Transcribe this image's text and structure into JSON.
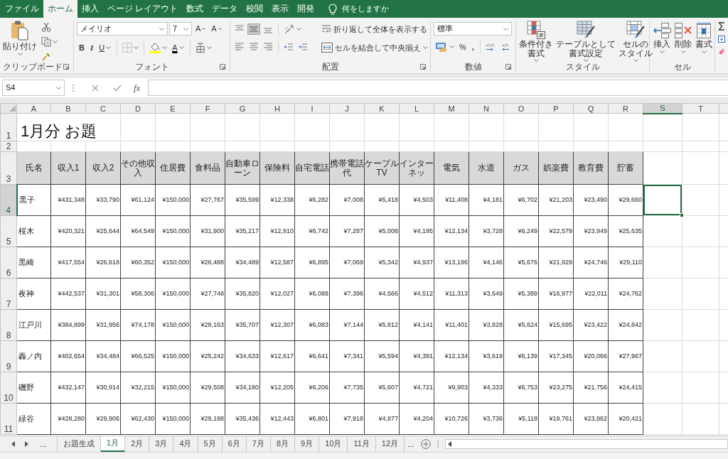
{
  "ribbon_tabs": [
    {
      "label": "ファイル",
      "selected": false
    },
    {
      "label": "ホーム",
      "selected": true
    },
    {
      "label": "挿入",
      "selected": false
    },
    {
      "label": "ページ レイアウト",
      "selected": false
    },
    {
      "label": "数式",
      "selected": false
    },
    {
      "label": "データ",
      "selected": false
    },
    {
      "label": "校閲",
      "selected": false
    },
    {
      "label": "表示",
      "selected": false
    },
    {
      "label": "開発",
      "selected": false
    }
  ],
  "tell_me": "何をしますか",
  "ribbon": {
    "clipboard": {
      "paste": "貼り付け",
      "label": "クリップボード"
    },
    "font": {
      "name": "メイリオ",
      "size": "7",
      "grow": "A",
      "shrink": "A",
      "bold": "B",
      "italic": "I",
      "underline": "U",
      "font_color": "A",
      "label": "フォント"
    },
    "alignment": {
      "vertical": [
        {
          "kind": "top",
          "selected": false
        },
        {
          "kind": "middle",
          "selected": true
        },
        {
          "kind": "bottom",
          "selected": false
        }
      ],
      "horizontal": [
        {
          "kind": "left",
          "selected": false
        },
        {
          "kind": "center",
          "selected": false
        },
        {
          "kind": "right",
          "selected": false
        }
      ],
      "wrap_text": "折り返して全体を表示する",
      "merge": "セルを結合して中央揃え",
      "label": "配置"
    },
    "number": {
      "format": "標準",
      "percent": "%",
      "comma": ",",
      "label": "数値"
    },
    "styles": {
      "buttons": [
        {
          "kind": "conditional",
          "lines": [
            "条件付き",
            "書式"
          ]
        },
        {
          "kind": "table",
          "lines": [
            "テーブルとして",
            "書式設定"
          ]
        },
        {
          "kind": "cell",
          "lines": [
            "セルの",
            "スタイル"
          ]
        }
      ],
      "label": "スタイル"
    },
    "cells": {
      "buttons": [
        {
          "kind": "insert",
          "label": "挿入"
        },
        {
          "kind": "delete",
          "label": "削除"
        },
        {
          "kind": "format",
          "label": "書式"
        }
      ],
      "label": "セル"
    }
  },
  "formula_bar": {
    "name_box": "S4",
    "function": "fx"
  },
  "sheet": {
    "columns": [
      {
        "label": "A",
        "selected": false
      },
      {
        "label": "B",
        "selected": false
      },
      {
        "label": "C",
        "selected": false
      },
      {
        "label": "D",
        "selected": false
      },
      {
        "label": "E",
        "selected": false
      },
      {
        "label": "F",
        "selected": false
      },
      {
        "label": "G",
        "selected": false
      },
      {
        "label": "H",
        "selected": false
      },
      {
        "label": "I",
        "selected": false
      },
      {
        "label": "J",
        "selected": false
      },
      {
        "label": "K",
        "selected": false
      },
      {
        "label": "L",
        "selected": false
      },
      {
        "label": "M",
        "selected": false
      },
      {
        "label": "N",
        "selected": false
      },
      {
        "label": "O",
        "selected": false
      },
      {
        "label": "P",
        "selected": false
      },
      {
        "label": "Q",
        "selected": false
      },
      {
        "label": "R",
        "selected": false
      },
      {
        "label": "S",
        "selected": true
      },
      {
        "label": "T",
        "selected": false
      }
    ],
    "rows": [
      {
        "number": "1",
        "selected": false,
        "kind": "title",
        "title": "1月分 お題"
      },
      {
        "number": "2",
        "selected": false,
        "kind": "blank"
      },
      {
        "number": "3",
        "selected": false,
        "kind": "header",
        "cells": [
          "氏名",
          "収入1",
          "収入2",
          "その他収入",
          "住居費",
          "食料品",
          "自動車ローン",
          "保険料",
          "自宅電話",
          "携帯電話代",
          "ケーブルTV",
          "インターネッ",
          "電気",
          "水道",
          "ガス",
          "娯楽費",
          "教育費",
          "貯蓄"
        ]
      },
      {
        "number": "4",
        "selected": true,
        "kind": "data",
        "cells": [
          "黒子",
          "¥431,348",
          "¥33,790",
          "¥61,124",
          "¥150,000",
          "¥27,767",
          "¥35,599",
          "¥12,338",
          "¥6,282",
          "¥7,008",
          "¥5,418",
          "¥4,503",
          "¥11,408",
          "¥4,181",
          "¥6,702",
          "¥21,203",
          "¥23,490",
          "¥29,660"
        ]
      },
      {
        "number": "5",
        "selected": false,
        "kind": "data",
        "cells": [
          "桜木",
          "¥420,321",
          "¥25,644",
          "¥64,549",
          "¥150,000",
          "¥31,900",
          "¥35,217",
          "¥12,910",
          "¥6,742",
          "¥7,287",
          "¥5,008",
          "¥4,195",
          "¥12,134",
          "¥3,728",
          "¥6,249",
          "¥22,579",
          "¥23,949",
          "¥25,635"
        ]
      },
      {
        "number": "6",
        "selected": false,
        "kind": "data",
        "cells": [
          "黒崎",
          "¥417,554",
          "¥26,618",
          "¥60,352",
          "¥150,000",
          "¥26,488",
          "¥34,489",
          "¥12,587",
          "¥6,895",
          "¥7,069",
          "¥5,342",
          "¥4,937",
          "¥13,196",
          "¥4,146",
          "¥5,676",
          "¥21,929",
          "¥24,746",
          "¥29,110"
        ]
      },
      {
        "number": "7",
        "selected": false,
        "kind": "data",
        "cells": [
          "夜神",
          "¥442,537",
          "¥31,301",
          "¥58,306",
          "¥150,000",
          "¥27,748",
          "¥35,820",
          "¥12,027",
          "¥6,088",
          "¥7,396",
          "¥4,566",
          "¥4,512",
          "¥11,313",
          "¥3,649",
          "¥5,389",
          "¥16,977",
          "¥22,011",
          "¥24,762"
        ]
      },
      {
        "number": "8",
        "selected": false,
        "kind": "data",
        "cells": [
          "江戸川",
          "¥384,899",
          "¥31,956",
          "¥74,178",
          "¥150,000",
          "¥28,163",
          "¥35,707",
          "¥12,307",
          "¥6,083",
          "¥7,144",
          "¥5,812",
          "¥4,141",
          "¥11,401",
          "¥3,828",
          "¥5,624",
          "¥15,695",
          "¥23,422",
          "¥24,842"
        ]
      },
      {
        "number": "9",
        "selected": false,
        "kind": "data",
        "cells": [
          "轟ノ内",
          "¥402,654",
          "¥34,484",
          "¥66,525",
          "¥150,000",
          "¥25,242",
          "¥34,633",
          "¥12,617",
          "¥6,641",
          "¥7,341",
          "¥5,594",
          "¥4,391",
          "¥12,134",
          "¥3,619",
          "¥6,139",
          "¥17,345",
          "¥20,066",
          "¥27,967"
        ]
      },
      {
        "number": "10",
        "selected": false,
        "kind": "data",
        "cells": [
          "磯野",
          "¥432,147",
          "¥30,914",
          "¥32,215",
          "¥150,000",
          "¥29,508",
          "¥34,180",
          "¥12,205",
          "¥6,206",
          "¥7,735",
          "¥5,607",
          "¥4,721",
          "¥9,903",
          "¥4,333",
          "¥6,753",
          "¥23,275",
          "¥21,756",
          "¥24,415"
        ]
      },
      {
        "number": "11",
        "selected": false,
        "kind": "data",
        "cells": [
          "緑谷",
          "¥428,280",
          "¥29,906",
          "¥62,430",
          "¥150,000",
          "¥29,198",
          "¥35,436",
          "¥12,443",
          "¥6,801",
          "¥7,918",
          "¥4,877",
          "¥4,204",
          "¥10,726",
          "¥3,736",
          "¥5,118",
          "¥19,761",
          "¥23,962",
          "¥20,421"
        ]
      }
    ]
  },
  "sheet_tabs": {
    "before": "...",
    "tabs": [
      {
        "label": "お題生成",
        "selected": false
      },
      {
        "label": "1月",
        "selected": true
      },
      {
        "label": "2月",
        "selected": false
      },
      {
        "label": "3月",
        "selected": false
      },
      {
        "label": "4月",
        "selected": false
      },
      {
        "label": "5月",
        "selected": false
      },
      {
        "label": "6月",
        "selected": false
      },
      {
        "label": "7月",
        "selected": false
      },
      {
        "label": "8月",
        "selected": false
      },
      {
        "label": "9月",
        "selected": false
      },
      {
        "label": "10月",
        "selected": false
      },
      {
        "label": "11月",
        "selected": false
      },
      {
        "label": "12月",
        "selected": false
      }
    ],
    "after": "..."
  }
}
